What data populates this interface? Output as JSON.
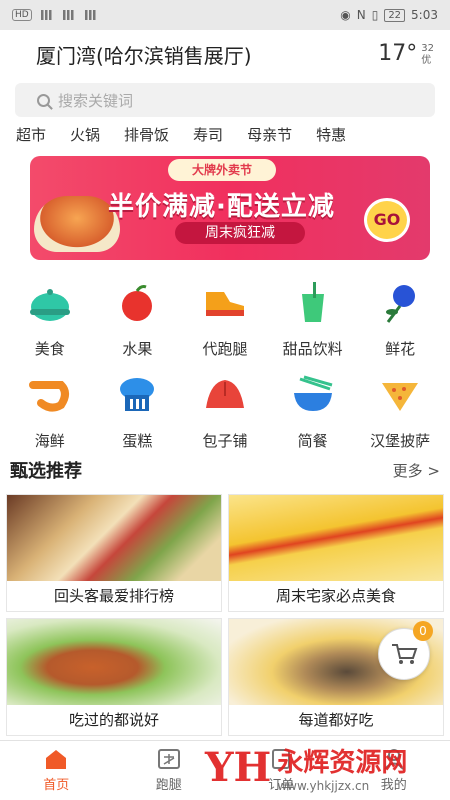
{
  "status_bar": {
    "left": "HD 4G 4G",
    "battery": "22",
    "time": "5:03"
  },
  "header": {
    "location": "厦门湾(哈尔滨销售展厅)",
    "temperature": "17°",
    "wx_code": "32",
    "air_quality": "优"
  },
  "search": {
    "placeholder": "搜索关键词"
  },
  "quick_tags": [
    "超市",
    "火锅",
    "排骨饭",
    "寿司",
    "母亲节",
    "特惠"
  ],
  "banner": {
    "top_label": "大牌外卖节",
    "headline": "半价满减·配送立减",
    "subline": "周末疯狂减",
    "button": "GO"
  },
  "categories": [
    {
      "label": "美食",
      "icon": "cloche-icon"
    },
    {
      "label": "水果",
      "icon": "apple-icon"
    },
    {
      "label": "代跑腿",
      "icon": "shoe-icon"
    },
    {
      "label": "甜品饮料",
      "icon": "drink-icon"
    },
    {
      "label": "鲜花",
      "icon": "rose-icon"
    },
    {
      "label": "海鲜",
      "icon": "shrimp-icon"
    },
    {
      "label": "蛋糕",
      "icon": "cake-icon"
    },
    {
      "label": "包子铺",
      "icon": "bun-icon"
    },
    {
      "label": "简餐",
      "icon": "bowl-icon"
    },
    {
      "label": "汉堡披萨",
      "icon": "pizza-icon"
    }
  ],
  "section": {
    "title": "甄选推荐",
    "more": "更多 >"
  },
  "recommend": [
    {
      "caption": "回头客最爱排行榜"
    },
    {
      "caption": "周末宅家必点美食"
    },
    {
      "caption": "吃过的都说好"
    },
    {
      "caption": "每道都好吃"
    }
  ],
  "cart": {
    "count": "0"
  },
  "tabs": [
    {
      "label": "首页",
      "active": true
    },
    {
      "label": "跑腿",
      "active": false
    },
    {
      "label": "订单",
      "active": false
    },
    {
      "label": "我的",
      "active": false
    }
  ],
  "watermark": {
    "logo": "YH",
    "name": "永辉资源网",
    "url": "www.yhkjjzx.cn"
  },
  "colors": {
    "accent": "#f05a28",
    "banner": "#f1305e",
    "cart_badge": "#f5a623"
  }
}
